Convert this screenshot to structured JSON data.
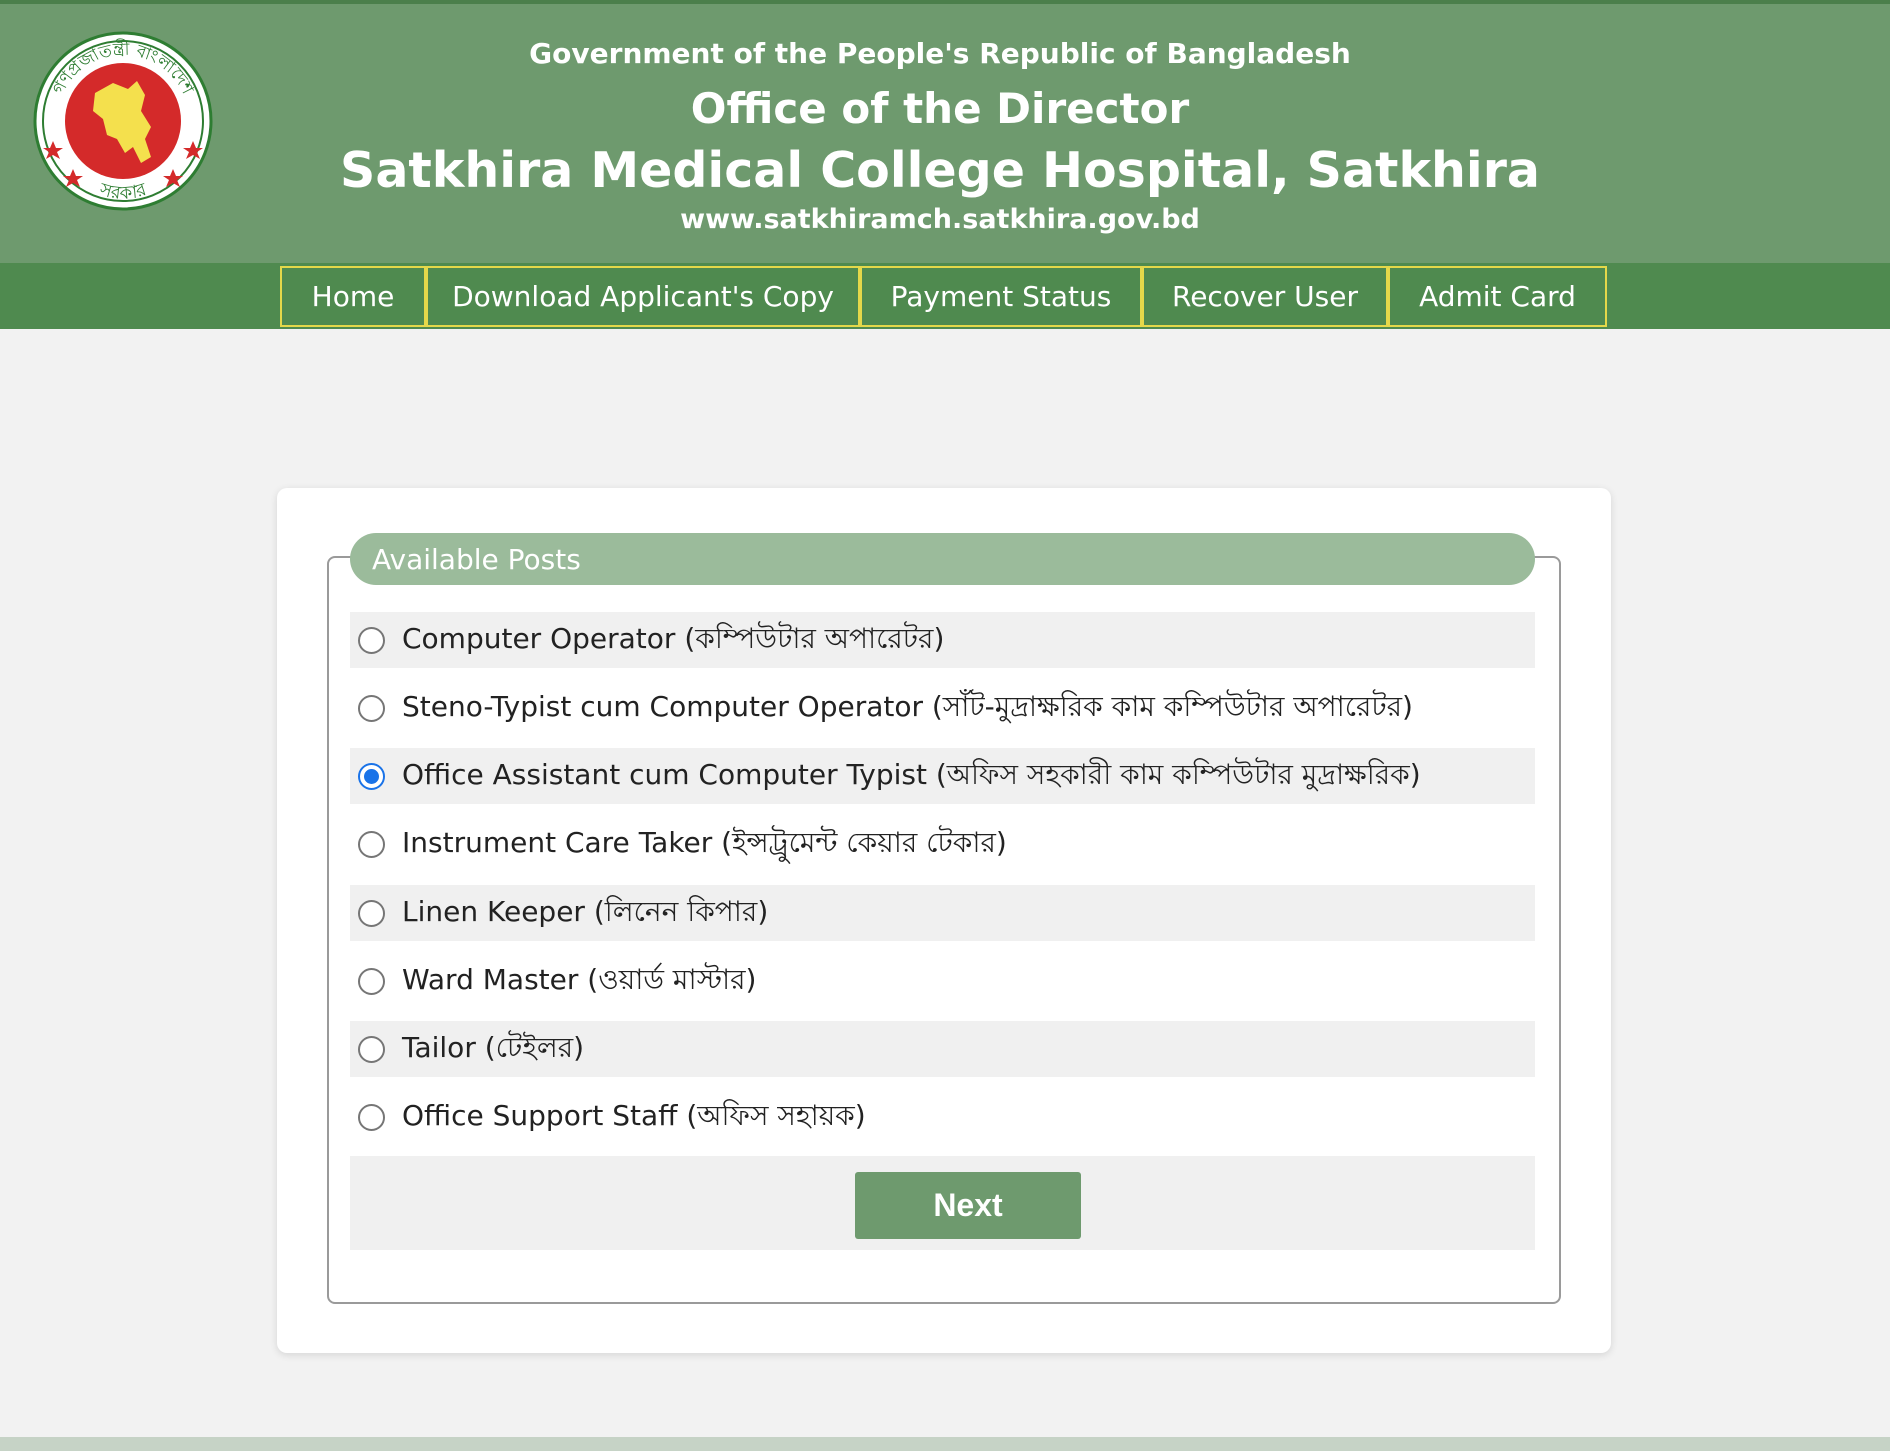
{
  "header": {
    "government": "Government of the People's Republic of Bangladesh",
    "office": "Office of the Director",
    "hospital": "Satkhira Medical College Hospital, Satkhira",
    "website": "www.satkhiramch.satkhira.gov.bd",
    "logo_text_top": "গণপ্রজাতন্ত্রী বাংলাদেশ",
    "logo_text_bottom": "সরকার"
  },
  "nav": {
    "items": [
      {
        "label": "Home"
      },
      {
        "label": "Download Applicant's Copy"
      },
      {
        "label": "Payment Status"
      },
      {
        "label": "Recover User"
      },
      {
        "label": "Admit Card"
      }
    ]
  },
  "posts": {
    "legend": "Available Posts",
    "options": [
      {
        "label": "Computer Operator (কম্পিউটার অপারেটর)",
        "selected": false
      },
      {
        "label": "Steno-Typist cum Computer Operator (সাঁট-মুদ্রাক্ষরিক কাম কম্পিউটার অপারেটর)",
        "selected": false
      },
      {
        "label": "Office Assistant cum Computer Typist (অফিস সহকারী কাম কম্পিউটার মুদ্রাক্ষরিক)",
        "selected": true
      },
      {
        "label": "Instrument Care Taker (ইন্সট্রুমেন্ট কেয়ার টেকার)",
        "selected": false
      },
      {
        "label": "Linen Keeper (লিনেন কিপার)",
        "selected": false
      },
      {
        "label": "Ward Master (ওয়ার্ড মাস্টার)",
        "selected": false
      },
      {
        "label": "Tailor (টেইলর)",
        "selected": false
      },
      {
        "label": "Office Support Staff (অফিস সহায়ক)",
        "selected": false
      }
    ],
    "next_label": "Next"
  },
  "colors": {
    "header_bg": "#6e9a6e",
    "nav_bg": "#4f8a4f",
    "nav_border": "#e4d84a",
    "legend_bg": "#9bbb9b",
    "radio_selected": "#1a73e8",
    "emblem_red": "#d42a2a",
    "emblem_yellow": "#f4e04d"
  }
}
